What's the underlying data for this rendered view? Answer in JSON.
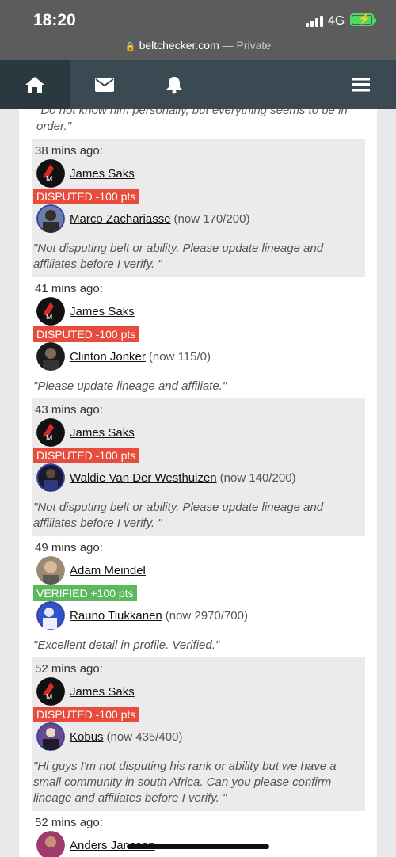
{
  "status_bar": {
    "time": "18:20",
    "network": "4G"
  },
  "url_bar": {
    "domain": "beltchecker.com",
    "mode": "— Private"
  },
  "nav": {
    "icons": [
      "home-icon",
      "mail-icon",
      "bell-icon",
      "menu-icon"
    ],
    "active": "home"
  },
  "colors": {
    "disputed": "#e74c3c",
    "verified": "#5cb85c",
    "nav_bg": "#3b4a52"
  },
  "feed": {
    "top_quote": "\"Do not know him personally, but everything seems to be in order.\"",
    "entries": [
      {
        "time": "38 mins ago:",
        "reviewer": "James Saks",
        "action": "DISPUTED -100 pts",
        "subject": "Marco Zachariasse",
        "subject_note": "(now 170/200)",
        "comment": "\"Not disputing belt or ability. Please update lineage and affiliates before I verify. \""
      },
      {
        "time": "41 mins ago:",
        "reviewer": "James Saks",
        "action": "DISPUTED -100 pts",
        "subject": "Clinton Jonker",
        "subject_note": "(now 115/0)",
        "comment": "\"Please update lineage and affiliate.\""
      },
      {
        "time": "43 mins ago:",
        "reviewer": "James Saks",
        "action": "DISPUTED -100 pts",
        "subject": "Waldie Van Der Westhuizen",
        "subject_note": "(now 140/200)",
        "comment": "\"Not disputing belt or ability. Please update lineage and affiliates before I verify. \""
      },
      {
        "time": "49 mins ago:",
        "reviewer": "Adam Meindel",
        "action": "VERIFIED +100 pts",
        "subject": "Rauno Tiukkanen",
        "subject_note": "(now 2970/700)",
        "comment": "\"Excellent detail in profile. Verified.\""
      },
      {
        "time": "52 mins ago:",
        "reviewer": "James Saks",
        "action": "DISPUTED -100 pts",
        "subject": "Kobus",
        "subject_note": "(now 435/400)",
        "comment": "\"Hi guys I'm not disputing his rank or ability but we have a small community in south Africa. Can you please confirm lineage and affiliates before I verify. \""
      },
      {
        "time": "52 mins ago:",
        "reviewer": "Anders Jansson"
      }
    ]
  }
}
